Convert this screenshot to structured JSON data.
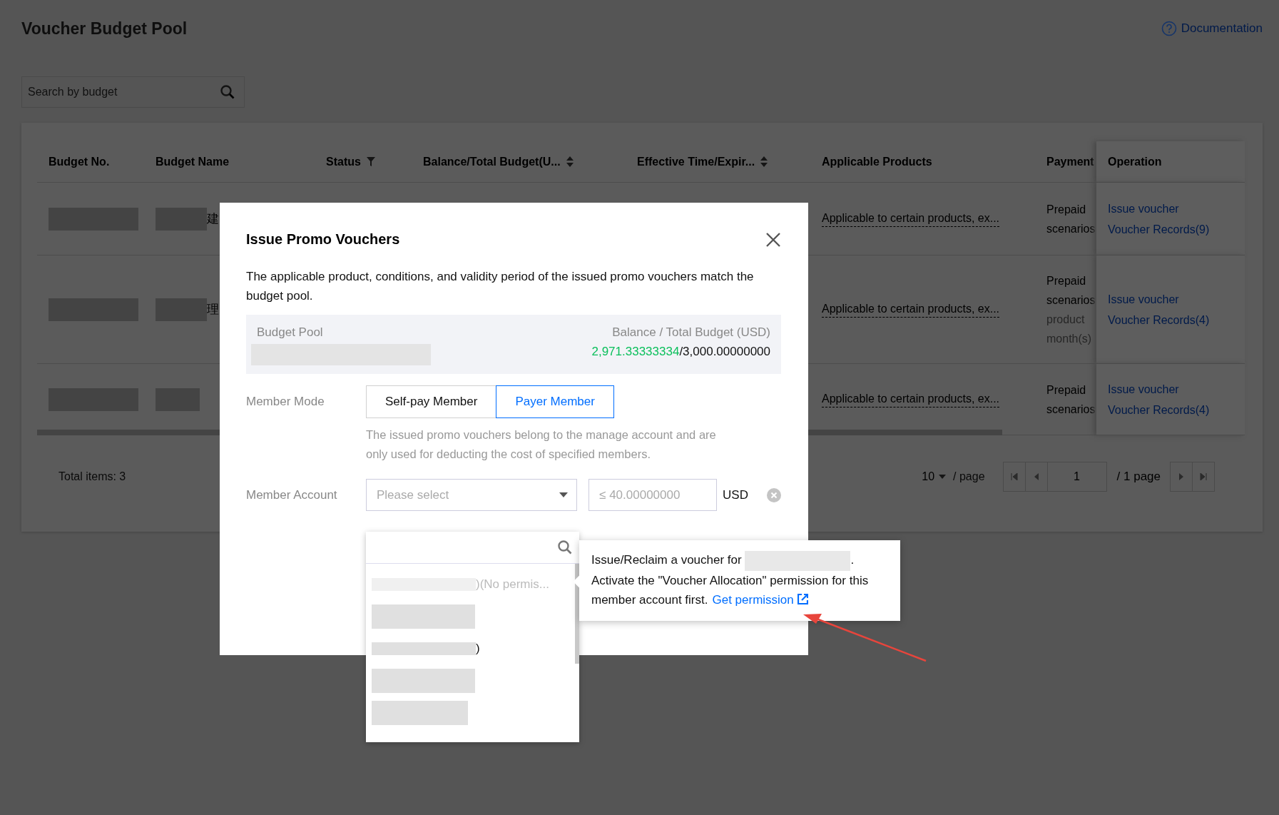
{
  "page": {
    "title": "Voucher Budget Pool",
    "documentation_link": "Documentation"
  },
  "search": {
    "placeholder": "Search by budget"
  },
  "table": {
    "columns": [
      {
        "label": "Budget No.",
        "kind": "plain"
      },
      {
        "label": "Budget Name",
        "kind": "plain"
      },
      {
        "label": "Status",
        "kind": "filterable"
      },
      {
        "label": "Balance/Total Budget(U...",
        "kind": "sortable"
      },
      {
        "label": "Effective Time/Expir...",
        "kind": "sortable"
      },
      {
        "label": "Applicable Products",
        "kind": "plain"
      },
      {
        "label": "Payment",
        "kind": "plain"
      },
      {
        "label": "Operation",
        "kind": "plain"
      }
    ],
    "rows": [
      {
        "budget_name_fragment": "建",
        "applicable_products": "Applicable to certain products, ex...",
        "payment": [
          {
            "text": "Prepaid",
            "muted": false
          },
          {
            "text": "scenarios",
            "muted": false
          }
        ],
        "actions": [
          "Issue voucher",
          "Voucher Records(9)"
        ]
      },
      {
        "budget_name_fragment": "理",
        "applicable_products": "Applicable to certain products, ex...",
        "payment": [
          {
            "text": "Prepaid",
            "muted": false
          },
          {
            "text": "scenarios",
            "muted": false
          },
          {
            "text": "product",
            "muted": true
          },
          {
            "text": "month(s)",
            "muted": true
          }
        ],
        "actions": [
          "Issue voucher",
          "Voucher Records(4)"
        ]
      },
      {
        "applicable_products": "Applicable to certain products, ex...",
        "payment": [
          {
            "text": "Prepaid",
            "muted": false
          },
          {
            "text": "scenarios",
            "muted": false
          }
        ],
        "actions": [
          "Issue voucher",
          "Voucher Records(4)"
        ]
      }
    ]
  },
  "footer": {
    "total": "Total items:  3",
    "page_size": "10",
    "per_page": "/ page",
    "page_input": "1",
    "page_total": "/ 1 page"
  },
  "modal": {
    "title": "Issue Promo Vouchers",
    "description": "The applicable product, conditions, and validity period of the issued promo vouchers match the budget pool.",
    "budget_pool": {
      "label": "Budget Pool",
      "balance_label": "Balance / Total Budget (USD)",
      "balance": "2,971.33333334",
      "total": "/3,000.00000000"
    },
    "member_mode": {
      "label": "Member Mode",
      "options": [
        {
          "label": "Self-pay Member",
          "selected": false
        },
        {
          "label": "Payer Member",
          "selected": true
        }
      ],
      "hint": "The issued promo vouchers belong to the manage account and are only used for deducting the cost of specified members."
    },
    "member_account": {
      "label": "Member Account",
      "select_placeholder": "Please select",
      "amount_placeholder": "≤ 40.00000000",
      "currency": "USD"
    },
    "dropdown": {
      "items": [
        {
          "suffix": ")(No permis...",
          "disabled": true
        },
        {
          "disabled": false
        },
        {
          "suffix": ")",
          "disabled": false
        },
        {
          "disabled": false
        },
        {
          "disabled": false
        }
      ]
    },
    "tooltip": {
      "before": "Issue/Reclaim a voucher for",
      "after": ". Activate the \"Voucher Allocation\" permission for this member account first.",
      "link": "Get permission"
    }
  }
}
